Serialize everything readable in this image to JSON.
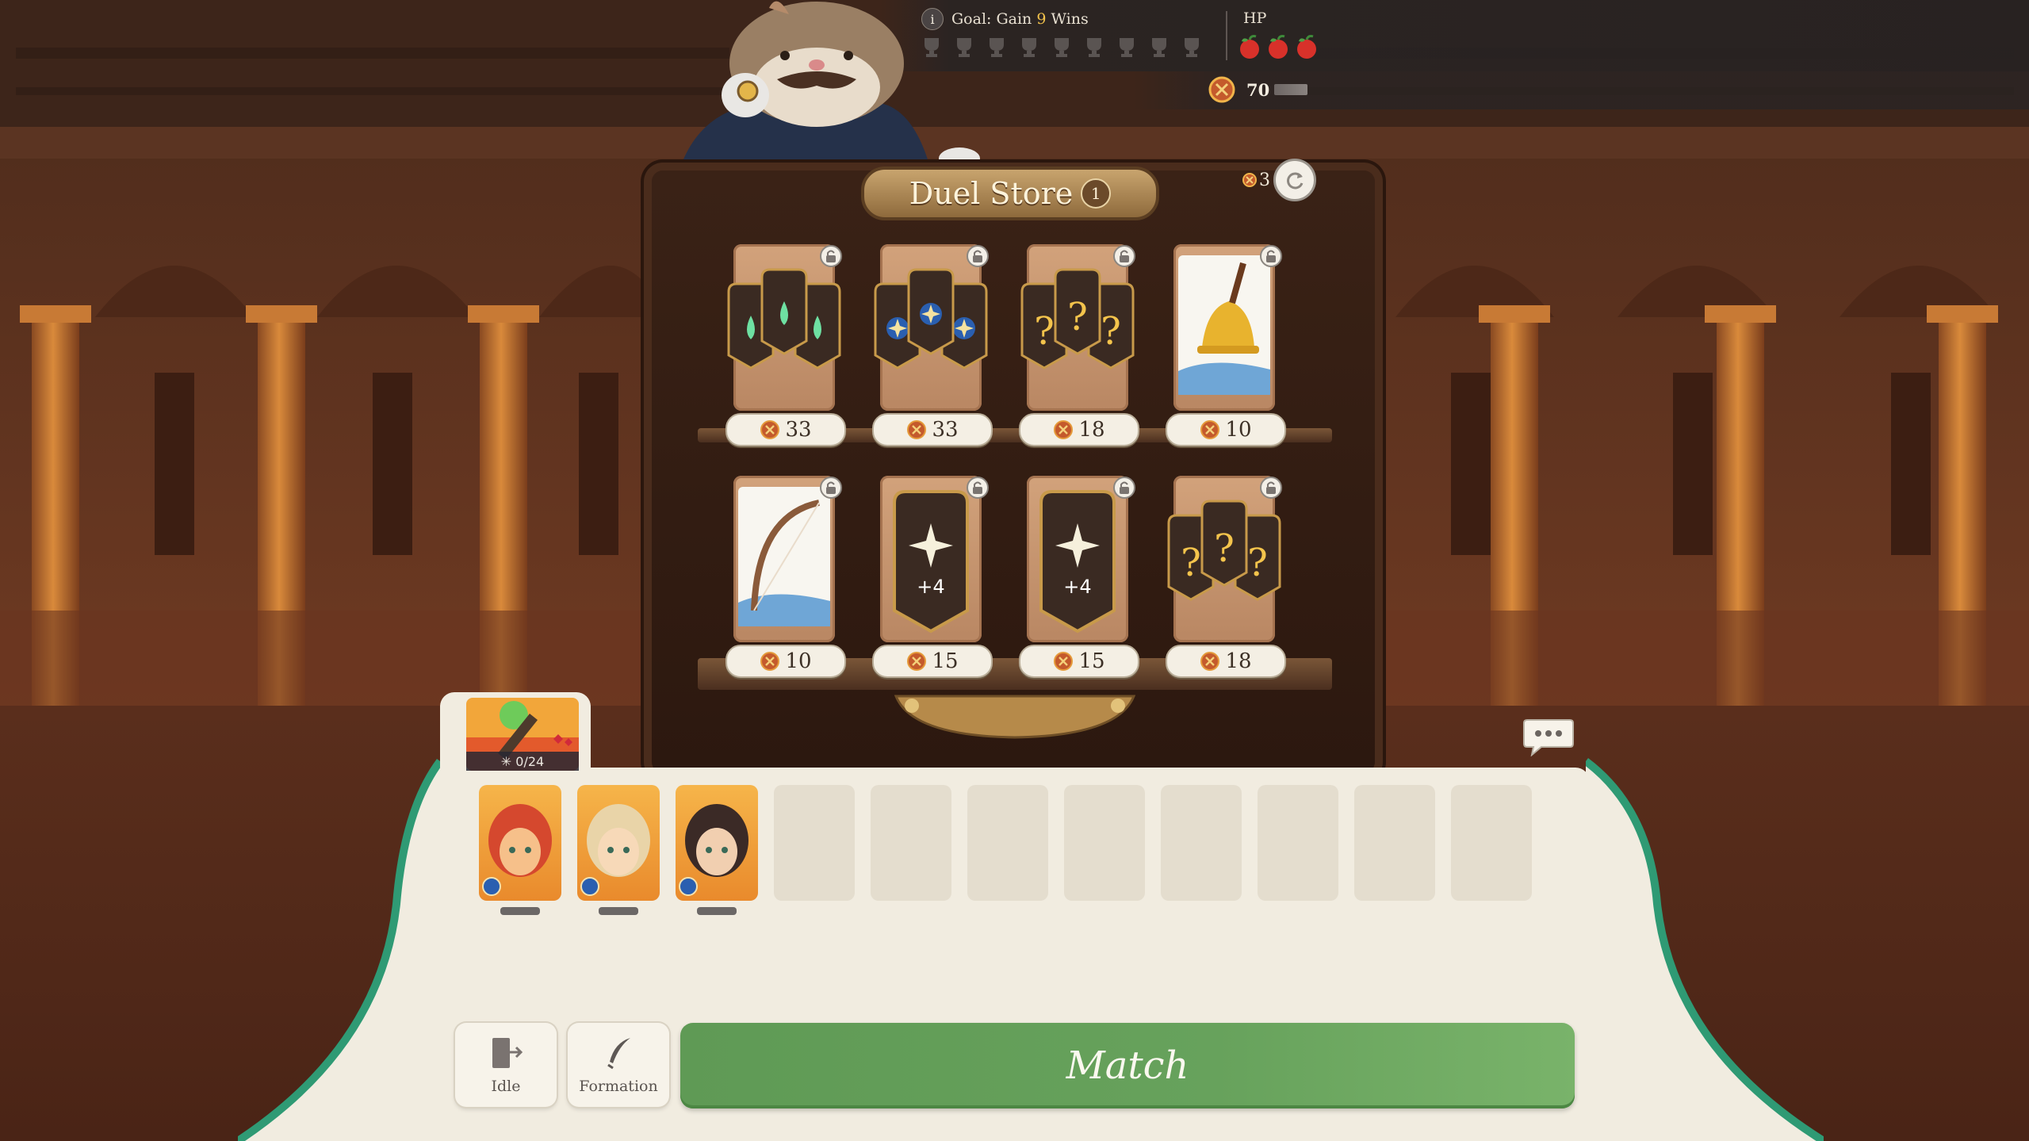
{
  "hud": {
    "goal_prefix": "Goal: Gain",
    "goal_number": "9",
    "goal_suffix": "Wins",
    "goal_trophies_total": 9,
    "goal_trophies_earned": 0,
    "hp_label": "HP",
    "hp_hearts": 3,
    "coins": "70",
    "info_icon": "i"
  },
  "store": {
    "title": "Duel Store",
    "level": "1",
    "refresh_cost": "3",
    "row1": [
      {
        "item": "three-nature-emblem-pack",
        "price": "33"
      },
      {
        "item": "three-star-emblem-pack",
        "price": "33"
      },
      {
        "item": "three-mystery-card-pack",
        "price": "18"
      },
      {
        "item": "bell",
        "price": "10"
      }
    ],
    "row2": [
      {
        "item": "bow",
        "price": "10"
      },
      {
        "item": "plus-four-badge",
        "label": "+4",
        "price": "15"
      },
      {
        "item": "plus-four-badge",
        "label": "+4",
        "price": "15"
      },
      {
        "item": "three-mystery-card-pack",
        "price": "18"
      }
    ]
  },
  "team": {
    "counter": "0/24",
    "heroes": [
      {
        "name": "hero-red-hair"
      },
      {
        "name": "hero-blonde-ears"
      },
      {
        "name": "hero-dark-braid"
      }
    ],
    "empty_slots": 8
  },
  "actions": {
    "idle_label": "Idle",
    "formation_label": "Formation",
    "match_label": "Match"
  },
  "colors": {
    "accent_green": "#67a25c",
    "gold": "#f4c44c",
    "panel": "#f1ece0"
  }
}
